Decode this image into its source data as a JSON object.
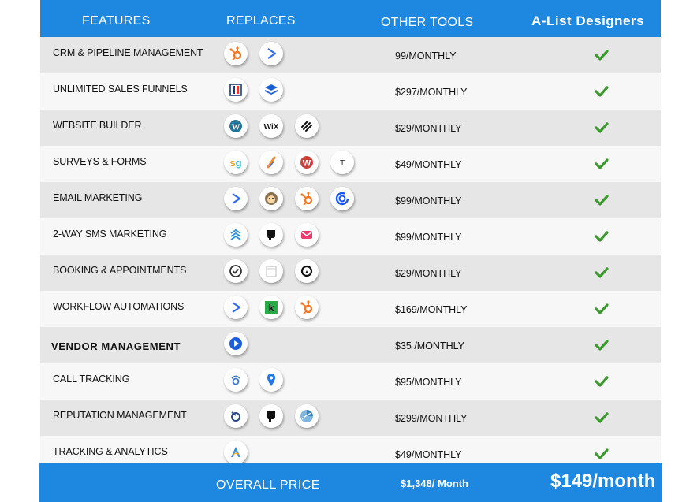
{
  "header": {
    "features": "FEATURES",
    "replaces": "REPLACES",
    "other_tools": "OTHER TOOLS",
    "brand": "A-List Designers"
  },
  "rows": [
    {
      "feature": "CRM & PIPELINE MANAGEMENT",
      "price": "99/MONTHLY",
      "icons": [
        "hubspot-icon",
        "activecampaign-icon"
      ]
    },
    {
      "feature": "UNLIMITED SALES FUNNELS",
      "price": "$297/MONTHLY",
      "icons": [
        "clickfunnels-icon",
        "layers-icon"
      ]
    },
    {
      "feature": "WEBSITE BUILDER",
      "price": "$29/MONTHLY",
      "icons": [
        "wordpress-icon",
        "wix-icon",
        "squarespace-icon"
      ]
    },
    {
      "feature": "SURVEYS & FORMS",
      "price": "$49/MONTHLY",
      "icons": [
        "surveygizmo-icon",
        "jotform-icon",
        "wufoo-icon",
        "typeform-icon"
      ]
    },
    {
      "feature": "EMAIL MARKETING",
      "price": "$99/MONTHLY",
      "icons": [
        "activecampaign-icon",
        "mailchimp-icon",
        "hubspot-icon",
        "constant-contact-icon"
      ]
    },
    {
      "feature": "2-WAY SMS MARKETING",
      "price": "$99/MONTHLY",
      "icons": [
        "stacks-icon",
        "podium-icon",
        "envelope-icon"
      ]
    },
    {
      "feature": "BOOKING & APPOINTMENTS",
      "price": "$29/MONTHLY",
      "icons": [
        "clock-check-icon",
        "calendar-icon",
        "acuity-icon"
      ]
    },
    {
      "feature": "WORKFLOW AUTOMATIONS",
      "price": "$169/MONTHLY",
      "icons": [
        "activecampaign-icon",
        "keap-icon",
        "hubspot-icon"
      ]
    },
    {
      "feature": "VENDOR MANAGEMENT",
      "price": "$35 /MONTHLY",
      "icons": [
        "play-icon"
      ]
    },
    {
      "feature": "CALL TRACKING",
      "price": "$95/MONTHLY",
      "icons": [
        "callrail-icon",
        "location-pin-icon"
      ]
    },
    {
      "feature": "REPUTATION MANAGEMENT",
      "price": "$299/MONTHLY",
      "icons": [
        "birdeye-icon",
        "podium-icon",
        "pie-icon"
      ]
    },
    {
      "feature": "TRACKING & ANALYTICS",
      "price": "$49/MONTHLY",
      "icons": [
        "analytics-icon"
      ]
    }
  ],
  "footer": {
    "label": "OVERALL PRICE",
    "other_total": "$1,348/ Month",
    "our_price": "$149/month"
  },
  "colors": {
    "accent": "#1e88e0",
    "check": "#3a9a2c",
    "row_dark": "#e6e6e6",
    "row_light": "#f7f7f7"
  }
}
